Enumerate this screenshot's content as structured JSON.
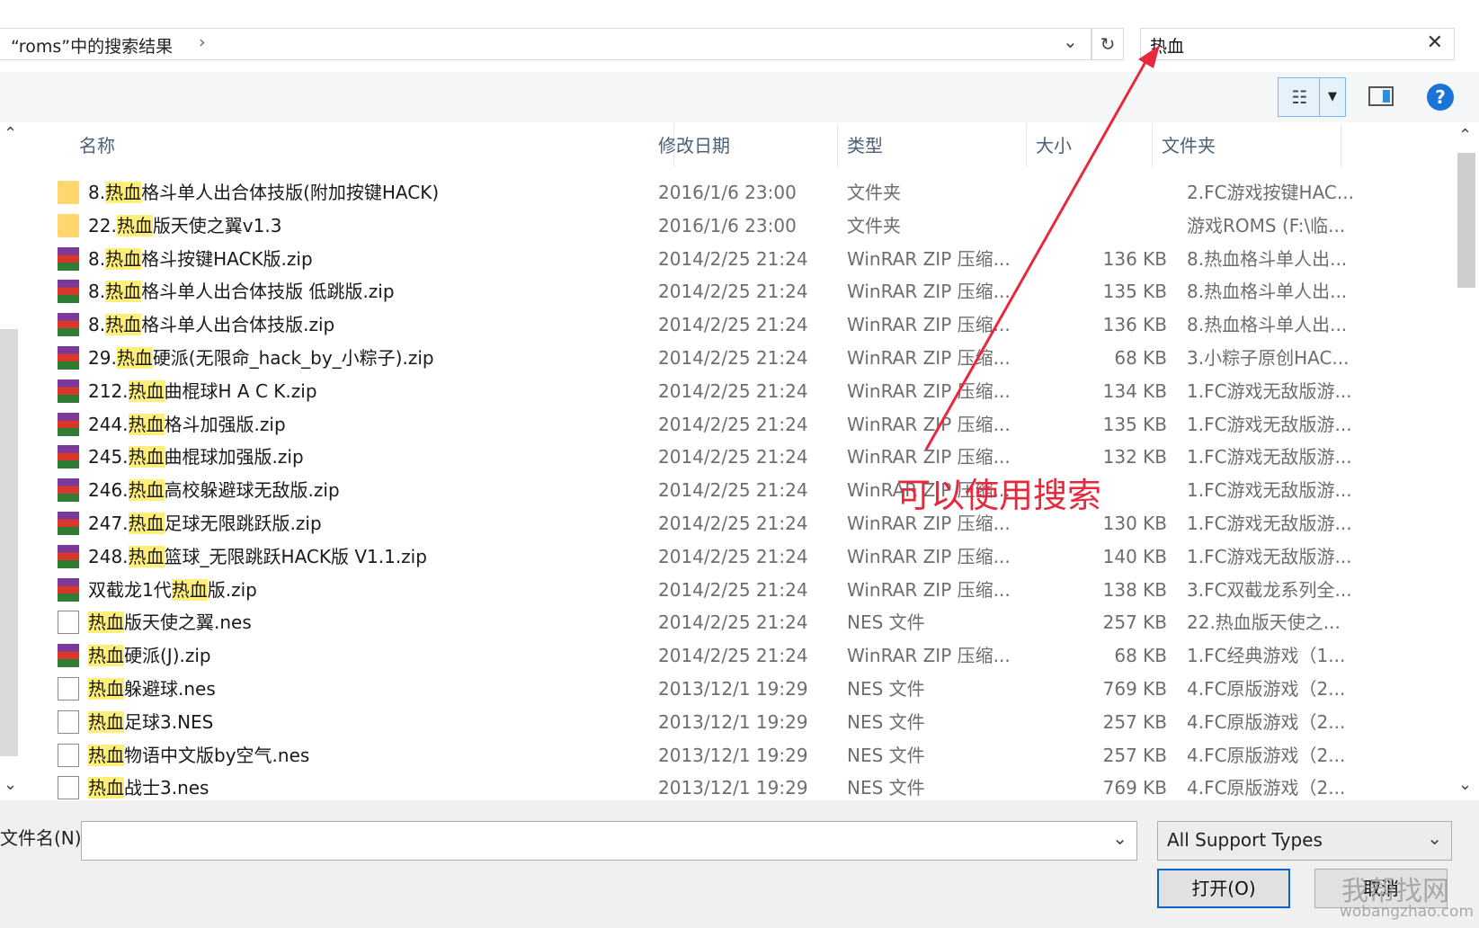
{
  "address": {
    "path": "“roms”中的搜索结果",
    "chevron": "›",
    "dropdown": "⌄"
  },
  "refresh": "↻",
  "search": {
    "value": "热血",
    "clear": "✕"
  },
  "toolbar": {
    "view_glyph": "☷",
    "view_dd": "▼",
    "help": "?"
  },
  "columns": {
    "name": "名称",
    "date": "修改日期",
    "type": "类型",
    "size": "大小",
    "folder": "文件夹"
  },
  "rows": [
    {
      "icon": "folder",
      "pre": "8.",
      "hl": "热血",
      "post": "格斗单人出合体技版(附加按键HACK)",
      "date": "2016/1/6 23:00",
      "type": "文件夹",
      "size": "",
      "folder": "2.FC游戏按键HAC..."
    },
    {
      "icon": "folder",
      "pre": "22.",
      "hl": "热血",
      "post": "版天使之翼v1.3",
      "date": "2016/1/6 23:00",
      "type": "文件夹",
      "size": "",
      "folder": "游戏ROMS (F:\\临..."
    },
    {
      "icon": "rar",
      "pre": "8.",
      "hl": "热血",
      "post": "格斗按键HACK版.zip",
      "date": "2014/2/25 21:24",
      "type": "WinRAR ZIP 压缩...",
      "size": "136 KB",
      "folder": "8.热血格斗单人出..."
    },
    {
      "icon": "rar",
      "pre": "8.",
      "hl": "热血",
      "post": "格斗单人出合体技版 低跳版.zip",
      "date": "2014/2/25 21:24",
      "type": "WinRAR ZIP 压缩...",
      "size": "135 KB",
      "folder": "8.热血格斗单人出..."
    },
    {
      "icon": "rar",
      "pre": "8.",
      "hl": "热血",
      "post": "格斗单人出合体技版.zip",
      "date": "2014/2/25 21:24",
      "type": "WinRAR ZIP 压缩...",
      "size": "136 KB",
      "folder": "8.热血格斗单人出..."
    },
    {
      "icon": "rar",
      "pre": "29.",
      "hl": "热血",
      "post": "硬派(无限命_hack_by_小粽子).zip",
      "date": "2014/2/25 21:24",
      "type": "WinRAR ZIP 压缩...",
      "size": "68 KB",
      "folder": "3.小粽子原创HAC..."
    },
    {
      "icon": "rar",
      "pre": "212.",
      "hl": "热血",
      "post": "曲棍球H A C K.zip",
      "date": "2014/2/25 21:24",
      "type": "WinRAR ZIP 压缩...",
      "size": "134 KB",
      "folder": "1.FC游戏无敌版游..."
    },
    {
      "icon": "rar",
      "pre": "244.",
      "hl": "热血",
      "post": "格斗加强版.zip",
      "date": "2014/2/25 21:24",
      "type": "WinRAR ZIP 压缩...",
      "size": "135 KB",
      "folder": "1.FC游戏无敌版游..."
    },
    {
      "icon": "rar",
      "pre": "245.",
      "hl": "热血",
      "post": "曲棍球加强版.zip",
      "date": "2014/2/25 21:24",
      "type": "WinRAR ZIP 压缩...",
      "size": "132 KB",
      "folder": "1.FC游戏无敌版游..."
    },
    {
      "icon": "rar",
      "pre": "246.",
      "hl": "热血",
      "post": "高校躲避球无敌版.zip",
      "date": "2014/2/25 21:24",
      "type": "WinRAR ZIP 压缩...",
      "size": "",
      "folder": "1.FC游戏无敌版游..."
    },
    {
      "icon": "rar",
      "pre": "247.",
      "hl": "热血",
      "post": "足球无限跳跃版.zip",
      "date": "2014/2/25 21:24",
      "type": "WinRAR ZIP 压缩...",
      "size": "130 KB",
      "folder": "1.FC游戏无敌版游..."
    },
    {
      "icon": "rar",
      "pre": "248.",
      "hl": "热血",
      "post": "篮球_无限跳跃HACK版 V1.1.zip",
      "date": "2014/2/25 21:24",
      "type": "WinRAR ZIP 压缩...",
      "size": "140 KB",
      "folder": "1.FC游戏无敌版游..."
    },
    {
      "icon": "rar",
      "pre": "双截龙1代",
      "hl": "热血",
      "post": "版.zip",
      "date": "2014/2/25 21:24",
      "type": "WinRAR ZIP 压缩...",
      "size": "138 KB",
      "folder": "3.FC双截龙系列全..."
    },
    {
      "icon": "file",
      "pre": "",
      "hl": "热血",
      "post": "版天使之翼.nes",
      "date": "2014/2/25 21:24",
      "type": "NES 文件",
      "size": "257 KB",
      "folder": "22.热血版天使之..."
    },
    {
      "icon": "rar",
      "pre": "",
      "hl": "热血",
      "post": "硬派(J).zip",
      "date": "2014/2/25 21:24",
      "type": "WinRAR ZIP 压缩...",
      "size": "68 KB",
      "folder": "1.FC经典游戏（1..."
    },
    {
      "icon": "file",
      "pre": "",
      "hl": "热血",
      "post": "躲避球.nes",
      "date": "2013/12/1 19:29",
      "type": "NES 文件",
      "size": "769 KB",
      "folder": "4.FC原版游戏（2..."
    },
    {
      "icon": "file",
      "pre": "",
      "hl": "热血",
      "post": "足球3.NES",
      "date": "2013/12/1 19:29",
      "type": "NES 文件",
      "size": "257 KB",
      "folder": "4.FC原版游戏（2..."
    },
    {
      "icon": "file",
      "pre": "",
      "hl": "热血",
      "post": "物语中文版by空气.nes",
      "date": "2013/12/1 19:29",
      "type": "NES 文件",
      "size": "257 KB",
      "folder": "4.FC原版游戏（2..."
    },
    {
      "icon": "file",
      "pre": "",
      "hl": "热血",
      "post": "战士3.nes",
      "date": "2013/12/1 19:29",
      "type": "NES 文件",
      "size": "769 KB",
      "folder": "4.FC原版游戏（2..."
    }
  ],
  "footer": {
    "filename_label": "文件名(N):",
    "filename_value": "",
    "filter_value": "All Support Types",
    "open_label": "打开(O)",
    "cancel_label": "取消"
  },
  "annotation": {
    "note": "可以使用搜索",
    "color": "#e8283c"
  },
  "watermark": {
    "line1": "我帮找网",
    "line2": "wobangzhao.com"
  }
}
